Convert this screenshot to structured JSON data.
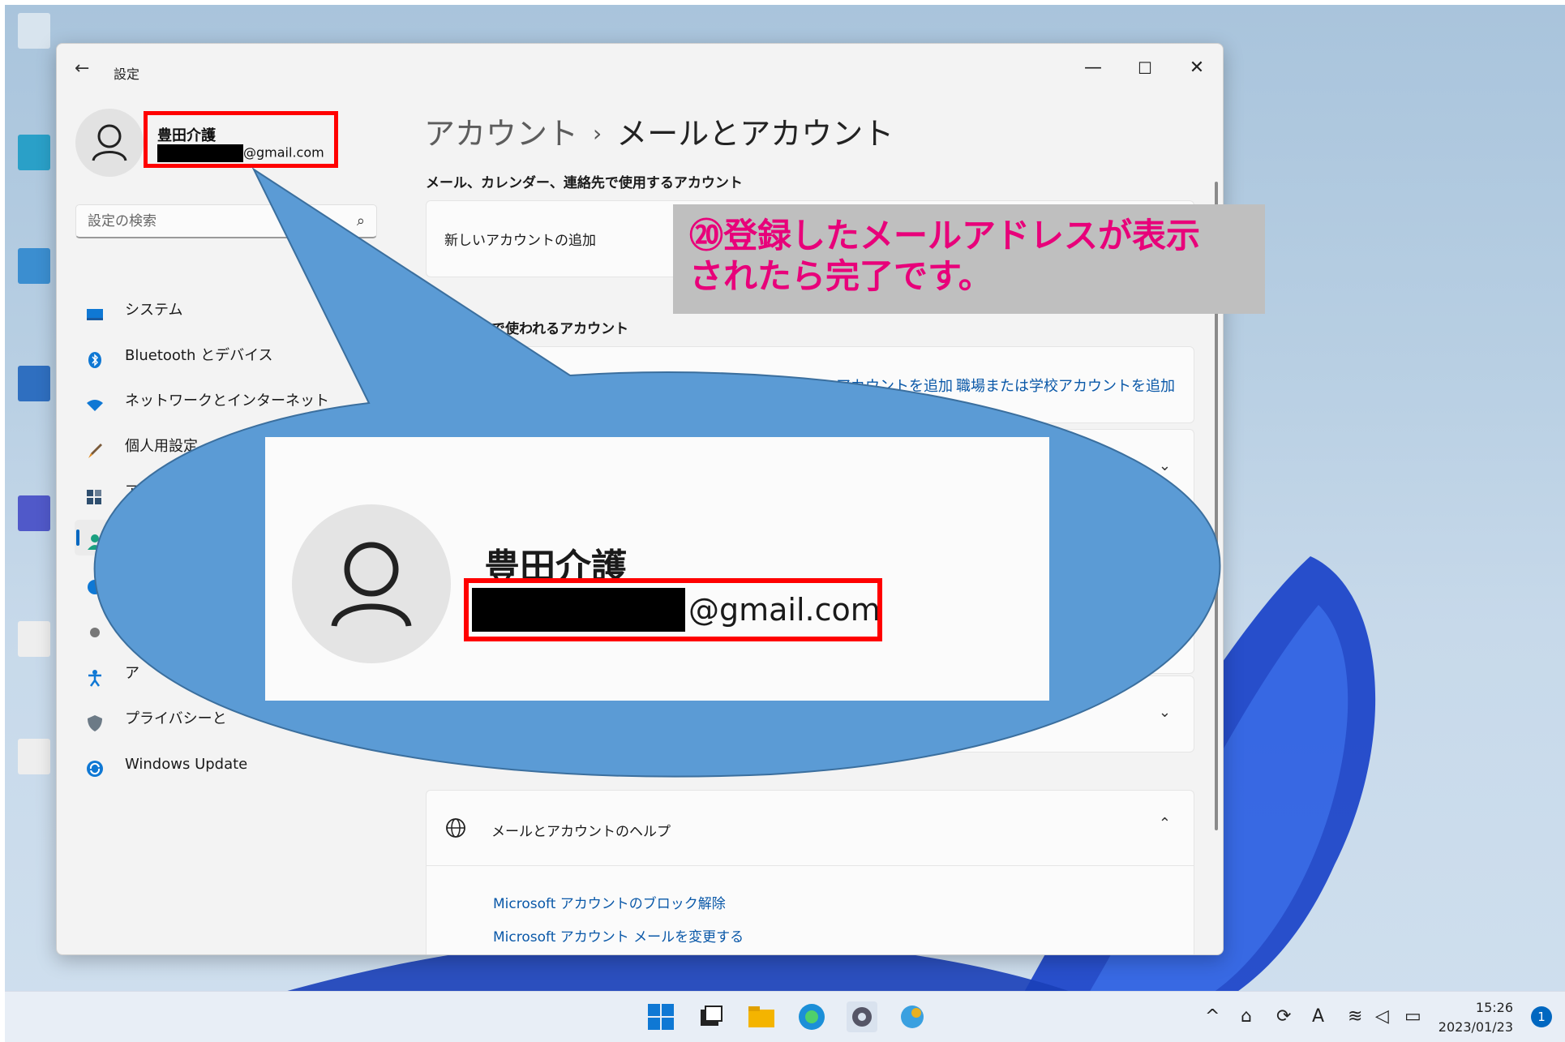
{
  "window": {
    "title": "設定",
    "minimize_glyph": "—",
    "maximize_glyph": "☐",
    "close_glyph": "✕"
  },
  "profile": {
    "name": "豊田介護",
    "email_suffix": "@gmail.com"
  },
  "search": {
    "placeholder": "設定の検索"
  },
  "sidebar": {
    "items": [
      {
        "label": "システム",
        "icon": "system-icon"
      },
      {
        "label": "Bluetooth とデバイス",
        "icon": "bluetooth-icon"
      },
      {
        "label": "ネットワークとインターネット",
        "icon": "network-icon"
      },
      {
        "label": "個人用設定",
        "icon": "brush-icon"
      },
      {
        "label": "アプリ",
        "icon": "apps-icon"
      },
      {
        "label": "",
        "icon": "accounts-icon"
      },
      {
        "label": "",
        "icon": "time-language-icon"
      },
      {
        "label": "",
        "icon": "gaming-icon"
      },
      {
        "label": "ア",
        "icon": "accessibility-icon"
      },
      {
        "label": "プライバシーと",
        "icon": "shield-icon"
      },
      {
        "label": "Windows Update",
        "icon": "update-icon"
      }
    ]
  },
  "main": {
    "breadcrumb_parent": "アカウント",
    "breadcrumb_separator": "›",
    "breadcrumb_current": "メールとアカウント",
    "section1": "メール、カレンダー、連絡先で使用するアカウント",
    "add_account": "新しいアカウントの追加",
    "section2_partial": "で使われるアカウント",
    "link_ms_partial": "アカウントを追加",
    "link_work": "職場または学校アカウントを追加",
    "help_title": "メールとアカウントのヘルプ",
    "help_links": [
      "Microsoft アカウントのブロック解除",
      "Microsoft アカウント メールを変更する"
    ]
  },
  "callout": {
    "name": "豊田介護",
    "email_suffix": "@gmail.com"
  },
  "annotation": {
    "line1": "⑳登録したメールアドレスが表示",
    "line2": "されたら完了です。",
    "color": "#e8007a"
  },
  "taskbar": {
    "time": "15:26",
    "date": "2023/01/23",
    "notification_count": "1",
    "tray_input": "A"
  }
}
